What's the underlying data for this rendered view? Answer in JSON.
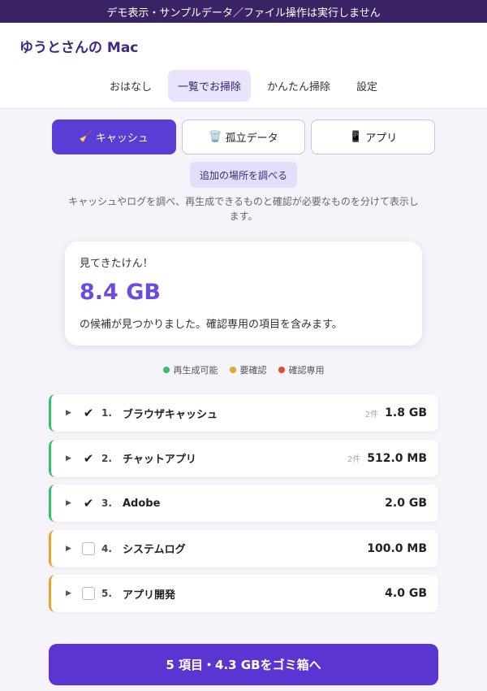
{
  "banner": "デモ表示・サンプルデータ／ファイル操作は実行しません",
  "app_title": "ゆうとさんの Mac",
  "nav_tabs": [
    {
      "label": "おはなし",
      "active": false
    },
    {
      "label": "一覧でお掃除",
      "active": true
    },
    {
      "label": "かんたん掃除",
      "active": false
    },
    {
      "label": "設定",
      "active": false
    }
  ],
  "modes": [
    {
      "icon": "🧹",
      "label": "キャッシュ",
      "active": true
    },
    {
      "icon": "🗑️",
      "label": "孤立データ",
      "active": false
    },
    {
      "icon": "📱",
      "label": "アプリ",
      "active": false
    }
  ],
  "extra_button": "追加の場所を調べる",
  "description": "キャッシュやログを調べ、再生成できるものと確認が必要なものを分けて表示します。",
  "summary": {
    "top": "見てきたけん！",
    "size": "8.4 GB",
    "bottom": "の候補が見つかりました。確認専用の項目を含みます。"
  },
  "legend": [
    {
      "label": "再生成可能",
      "color": "#34c16b"
    },
    {
      "label": "要確認",
      "color": "#e9a52a"
    },
    {
      "label": "確認専用",
      "color": "#e04a2f"
    }
  ],
  "items": [
    {
      "num": "1.",
      "name": "ブラウザキャッシュ",
      "count": "2件",
      "size": "1.8 GB",
      "checked": true,
      "status": "ok"
    },
    {
      "num": "2.",
      "name": "チャットアプリ",
      "count": "2件",
      "size": "512.0 MB",
      "checked": true,
      "status": "ok"
    },
    {
      "num": "3.",
      "name": "Adobe",
      "count": "",
      "size": "2.0 GB",
      "checked": true,
      "status": "ok"
    },
    {
      "num": "4.",
      "name": "システムログ",
      "count": "",
      "size": "100.0 MB",
      "checked": false,
      "status": "warn"
    },
    {
      "num": "5.",
      "name": "アプリ開発",
      "count": "",
      "size": "4.0 GB",
      "checked": false,
      "status": "warn"
    }
  ],
  "cta": "5 項目・4.3 GBをゴミ箱へ"
}
